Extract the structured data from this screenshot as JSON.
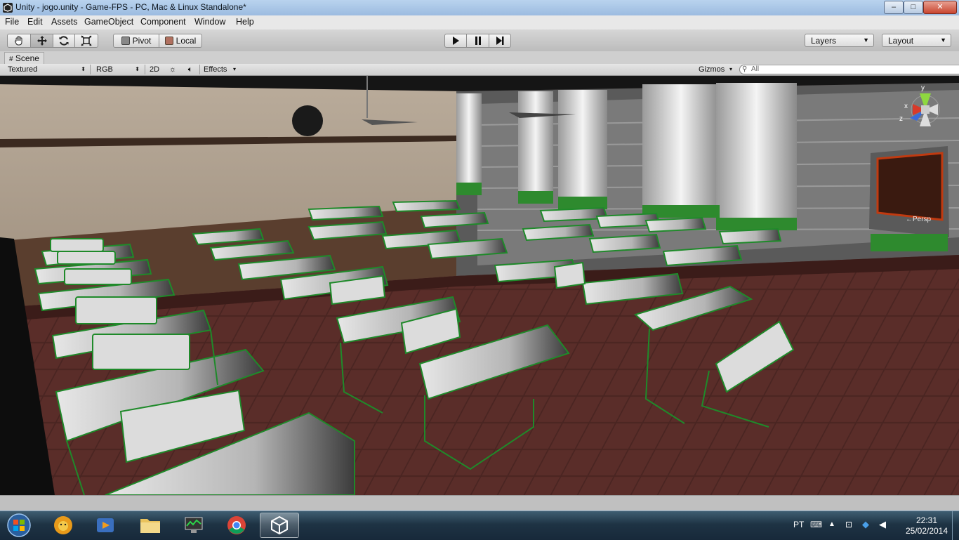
{
  "window": {
    "title": "Unity - jogo.unity - Game-FPS - PC, Mac & Linux Standalone*",
    "min_glyph": "–",
    "max_glyph": "□",
    "close_glyph": "✕"
  },
  "menu": [
    "File",
    "Edit",
    "Assets",
    "GameObject",
    "Component",
    "Window",
    "Help"
  ],
  "toolbar": {
    "pivot_label": "Pivot",
    "local_label": "Local",
    "layers_label": "Layers",
    "layout_label": "Layout"
  },
  "scene_tab": {
    "label": "Scene"
  },
  "scene_toolbar": {
    "render_mode": "Textured",
    "color_mode": "RGB",
    "mode_2d": "2D",
    "effects_label": "Effects",
    "gizmos_label": "Gizmos",
    "search_placeholder": "All"
  },
  "scene": {
    "gizmo_label": "←Persp",
    "gizmo_axes": {
      "x": "x",
      "y": "y",
      "z": "z"
    }
  },
  "taskbar": {
    "items": [
      "windows-start",
      "antivirus-lion",
      "media-player",
      "file-explorer",
      "task-manager",
      "chrome-browser",
      "unity-editor"
    ],
    "language": "PT",
    "time": "22:31",
    "date": "25/02/2014"
  }
}
